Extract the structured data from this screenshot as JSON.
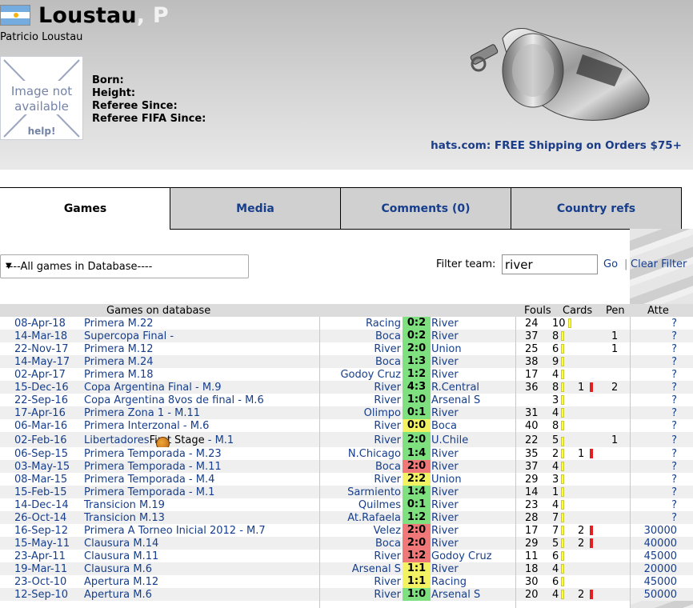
{
  "header": {
    "surname": "Loustau",
    "initial": ", P",
    "full_name": "Patricio Loustau",
    "no_image": {
      "line1": "Image not",
      "line2": "available",
      "help": "help!"
    },
    "info_labels": [
      "Born:",
      "Height:",
      "Referee Since:",
      "Referee FIFA Since:"
    ],
    "ad_text": "hats.com: FREE Shipping on Orders $75+"
  },
  "tabs": [
    "Games",
    "Media",
    "Comments (0)",
    "Country refs"
  ],
  "filter": {
    "select_value": "----All games in Database----",
    "label": "Filter team:",
    "input_value": "river",
    "go_label": "Go",
    "separator": "|",
    "clear_label": "Clear Filter"
  },
  "table": {
    "headers": {
      "games": "Games on database",
      "fouls": "Fouls",
      "cards": "Cards",
      "pen": "Pen",
      "att": "Atte"
    },
    "rows": [
      {
        "date": "08-Apr-18",
        "comp": "Primera M.22",
        "home": "Racing",
        "score": "0:2",
        "result": "green",
        "away": "River",
        "fouls": "24",
        "yc": "10",
        "rc": "",
        "pen": "",
        "att": "?"
      },
      {
        "date": "14-Mar-18",
        "comp": "Supercopa Final -",
        "home": "Boca",
        "score": "0:2",
        "result": "green",
        "away": "River",
        "fouls": "37",
        "yc": "8",
        "rc": "",
        "pen": "1",
        "att": "?"
      },
      {
        "date": "22-Nov-17",
        "comp": "Primera M.12",
        "home": "River",
        "score": "2:0",
        "result": "green",
        "away": "Union",
        "fouls": "25",
        "yc": "6",
        "rc": "",
        "pen": "1",
        "att": "?"
      },
      {
        "date": "14-May-17",
        "comp": "Primera M.24",
        "home": "Boca",
        "score": "1:3",
        "result": "green",
        "away": "River",
        "fouls": "38",
        "yc": "9",
        "rc": "",
        "pen": "",
        "att": "?"
      },
      {
        "date": "02-Apr-17",
        "comp": "Primera M.18",
        "home": "Godoy Cruz",
        "score": "1:2",
        "result": "green",
        "away": "River",
        "fouls": "17",
        "yc": "4",
        "rc": "",
        "pen": "",
        "att": "?"
      },
      {
        "date": "15-Dec-16",
        "comp": "Copa Argentina Final - M.9",
        "home": "River",
        "score": "4:3",
        "result": "green",
        "away": "R.Central",
        "fouls": "36",
        "yc": "8",
        "rc": "1",
        "pen": "2",
        "att": "?"
      },
      {
        "date": "22-Sep-16",
        "comp": "Copa Argentina 8vos de final - M.6",
        "home": "River",
        "score": "1:0",
        "result": "green",
        "away": "Arsenal S",
        "fouls": "",
        "yc": "3",
        "rc": "",
        "pen": "",
        "att": "?"
      },
      {
        "date": "17-Apr-16",
        "comp": "Primera Zona 1 - M.11",
        "home": "Olimpo",
        "score": "0:1",
        "result": "green",
        "away": "River",
        "fouls": "31",
        "yc": "4",
        "rc": "",
        "pen": "",
        "att": "?"
      },
      {
        "date": "06-Mar-16",
        "comp": "Primera Interzonal - M.6",
        "home": "River",
        "score": "0:0",
        "result": "yellow",
        "away": "Boca",
        "fouls": "40",
        "yc": "8",
        "rc": "",
        "pen": "",
        "att": "?"
      },
      {
        "date": "02-Feb-16",
        "comp": "Libertadores",
        "comp_extra": "First Stage",
        "comp_suffix": " - M.1",
        "home": "River",
        "score": "2:0",
        "result": "green",
        "away": "U.Chile",
        "fouls": "22",
        "yc": "5",
        "rc": "",
        "pen": "1",
        "att": "?"
      },
      {
        "date": "06-Sep-15",
        "comp": "Primera Temporada - M.23",
        "home": "N.Chicago",
        "score": "1:4",
        "result": "green",
        "away": "River",
        "fouls": "35",
        "yc": "2",
        "rc": "1",
        "pen": "",
        "att": "?"
      },
      {
        "date": "03-May-15",
        "comp": "Primera Temporada - M.11",
        "home": "Boca",
        "score": "2:0",
        "result": "red",
        "away": "River",
        "fouls": "37",
        "yc": "4",
        "rc": "",
        "pen": "",
        "att": "?"
      },
      {
        "date": "08-Mar-15",
        "comp": "Primera Temporada - M.4",
        "home": "River",
        "score": "2:2",
        "result": "yellow",
        "away": "Union",
        "fouls": "29",
        "yc": "3",
        "rc": "",
        "pen": "",
        "att": "?"
      },
      {
        "date": "15-Feb-15",
        "comp": "Primera Temporada - M.1",
        "home": "Sarmiento",
        "score": "1:4",
        "result": "green",
        "away": "River",
        "fouls": "14",
        "yc": "1",
        "rc": "",
        "pen": "",
        "att": "?"
      },
      {
        "date": "14-Dec-14",
        "comp": "Transicion M.19",
        "home": "Quilmes",
        "score": "0:1",
        "result": "green",
        "away": "River",
        "fouls": "23",
        "yc": "4",
        "rc": "",
        "pen": "",
        "att": "?"
      },
      {
        "date": "26-Oct-14",
        "comp": "Transicion M.13",
        "home": "At.Rafaela",
        "score": "1:2",
        "result": "green",
        "away": "River",
        "fouls": "28",
        "yc": "7",
        "rc": "",
        "pen": "",
        "att": "?"
      },
      {
        "date": "16-Sep-12",
        "comp": "Primera A Torneo Inicial 2012 - M.7",
        "home": "Velez",
        "score": "2:0",
        "result": "red",
        "away": "River",
        "fouls": "17",
        "yc": "7",
        "rc": "2",
        "pen": "",
        "att": "30000"
      },
      {
        "date": "15-May-11",
        "comp": "Clausura M.14",
        "home": "Boca",
        "score": "2:0",
        "result": "red",
        "away": "River",
        "fouls": "29",
        "yc": "5",
        "rc": "2",
        "pen": "",
        "att": "40000"
      },
      {
        "date": "23-Apr-11",
        "comp": "Clausura M.11",
        "home": "River",
        "score": "1:2",
        "result": "red",
        "away": "Godoy Cruz",
        "fouls": "11",
        "yc": "6",
        "rc": "",
        "pen": "",
        "att": "45000"
      },
      {
        "date": "19-Mar-11",
        "comp": "Clausura M.6",
        "home": "Arsenal S",
        "score": "1:1",
        "result": "yellow",
        "away": "River",
        "fouls": "18",
        "yc": "4",
        "rc": "",
        "pen": "",
        "att": "20000"
      },
      {
        "date": "23-Oct-10",
        "comp": "Apertura M.12",
        "home": "River",
        "score": "1:1",
        "result": "yellow",
        "away": "Racing",
        "fouls": "30",
        "yc": "6",
        "rc": "",
        "pen": "",
        "att": "45000"
      },
      {
        "date": "12-Sep-10",
        "comp": "Apertura M.6",
        "home": "River",
        "score": "1:0",
        "result": "green",
        "away": "Arsenal S",
        "fouls": "20",
        "yc": "4",
        "rc": "2",
        "pen": "",
        "att": "50000"
      }
    ]
  }
}
